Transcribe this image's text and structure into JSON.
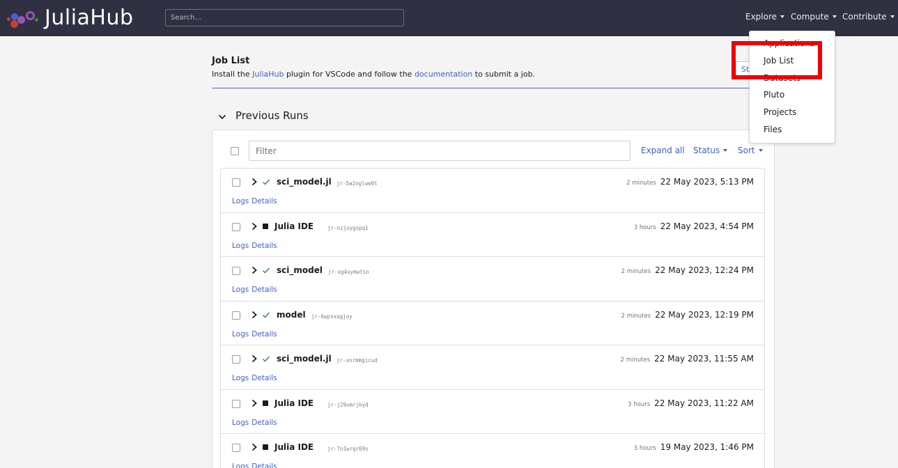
{
  "navbar": {
    "brand": "JuliaHub",
    "search_placeholder": "Search...",
    "menus": [
      "Explore",
      "Compute",
      "Contribute"
    ]
  },
  "header": {
    "title": "Job List",
    "desc_prefix": "Install the ",
    "desc_link1": "JuliaHub",
    "desc_middle": " plugin for VSCode and follow the ",
    "desc_link2": "documentation",
    "desc_suffix": " to submit a job.",
    "start_button": "Sta"
  },
  "previous_runs": {
    "title": "Previous Runs",
    "filter_placeholder": "Filter",
    "expand_all": "Expand all",
    "status_label": "Status",
    "sort_label": "Sort",
    "runs": [
      {
        "name": "sci_model.jl",
        "job_id": "jr-5a2nglwe0t",
        "status": "success",
        "duration": "2 minutes",
        "date": "22 May 2023, 5:13 PM",
        "logs": "Logs",
        "details": "Details"
      },
      {
        "name": "Julia IDE",
        "job_id": "jr-nzjuygspq1",
        "status": "stopped",
        "duration": "3 hours",
        "date": "22 May 2023, 4:54 PM",
        "logs": "Logs",
        "details": "Details"
      },
      {
        "name": "sci_model",
        "job_id": "jr-xg4uymwtsn",
        "status": "success",
        "duration": "2 minutes",
        "date": "22 May 2023, 12:24 PM",
        "logs": "Logs",
        "details": "Details"
      },
      {
        "name": "model",
        "job_id": "jr-6wpsxugjoy",
        "status": "success",
        "duration": "2 minutes",
        "date": "22 May 2023, 12:19 PM",
        "logs": "Logs",
        "details": "Details"
      },
      {
        "name": "sci_model.jl",
        "job_id": "jr-xnrmmgicud",
        "status": "success",
        "duration": "2 minutes",
        "date": "22 May 2023, 11:55 AM",
        "logs": "Logs",
        "details": "Details"
      },
      {
        "name": "Julia IDE",
        "job_id": "jr-j29vmrjhyd",
        "status": "stopped",
        "duration": "3 hours",
        "date": "22 May 2023, 11:22 AM",
        "logs": "Logs",
        "details": "Details"
      },
      {
        "name": "Julia IDE",
        "job_id": "jr-7n1wrqr69s",
        "status": "stopped",
        "duration": "3 hours",
        "date": "19 May 2023, 1:46 PM",
        "logs": "Logs",
        "details": "Details"
      }
    ]
  },
  "compute_dropdown": {
    "items": [
      "Applications",
      "Job List",
      "Datasets",
      "Pluto",
      "Projects",
      "Files"
    ]
  },
  "colors": {
    "navbar": "#2f3142",
    "link": "#3a5fcd",
    "success": "#2e8b3a",
    "highlight": "#f00000"
  }
}
